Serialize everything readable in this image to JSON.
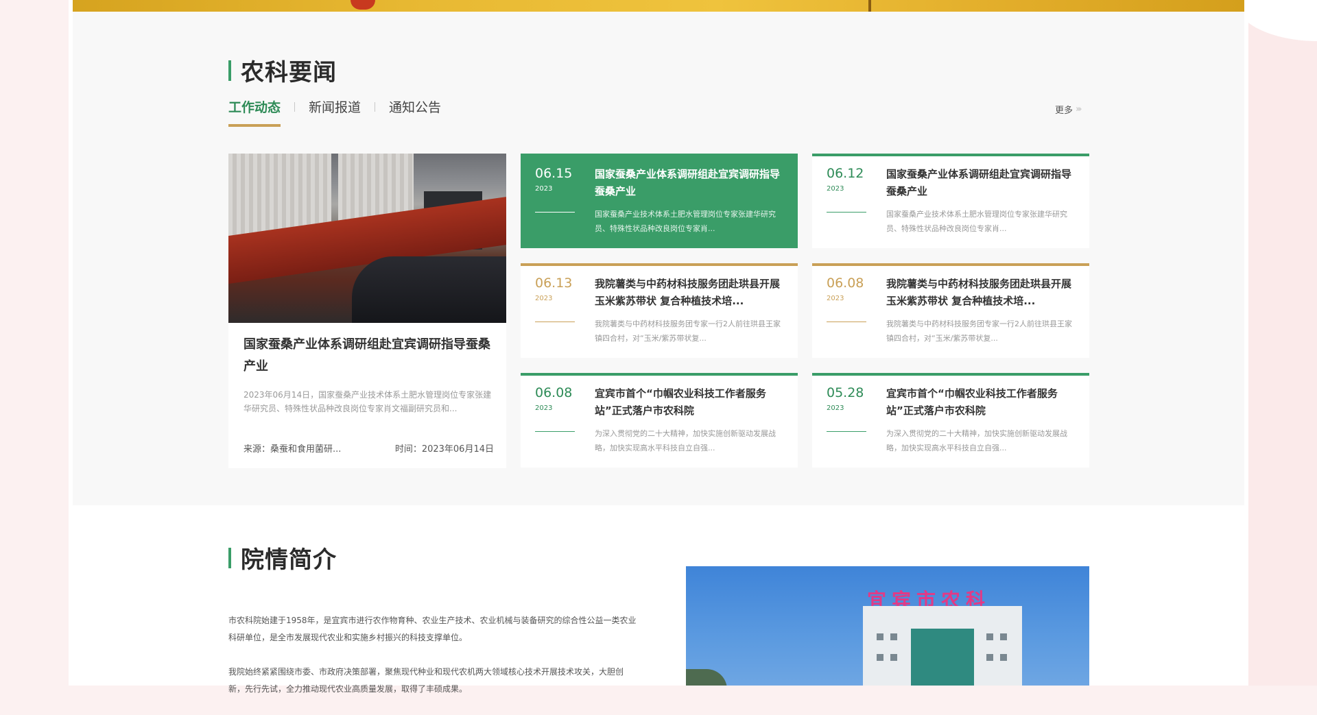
{
  "news_section": {
    "title": "农科要闻",
    "tabs": [
      {
        "label": "工作动态",
        "active": true
      },
      {
        "label": "新闻报道",
        "active": false
      },
      {
        "label": "通知公告",
        "active": false
      }
    ],
    "more_label": "更多",
    "featured": {
      "title": "国家蚕桑产业体系调研组赴宜宾调研指导蚕桑产业",
      "summary": "2023年06月14日，国家蚕桑产业技术体系土肥水管理岗位专家张建华研究员、特殊性状品种改良岗位专家肖文福副研究员和...",
      "source_label": "来源：",
      "source_value": "桑蚕和食用菌研...",
      "time_label": "时间：",
      "time_value": "2023年06月14日"
    },
    "cards": [
      {
        "date": "06.15",
        "year": "2023",
        "title": "国家蚕桑产业体系调研组赴宜宾调研指导蚕桑产业",
        "summary": "国家蚕桑产业技术体系土肥水管理岗位专家张建华研究员、特殊性状品种改良岗位专家肖...",
        "style": "highlight"
      },
      {
        "date": "06.12",
        "year": "2023",
        "title": "国家蚕桑产业体系调研组赴宜宾调研指导蚕桑产业",
        "summary": "国家蚕桑产业技术体系土肥水管理岗位专家张建华研究员、特殊性状品种改良岗位专家肖...",
        "style": "green"
      },
      {
        "date": "06.13",
        "year": "2023",
        "title": "我院薯类与中药材科技服务团赴珙县开展玉米紫苏带状 复合种植技术培...",
        "summary": "我院薯类与中药材科技服务团专家一行2人前往珙县王家镇四合村，对“玉米/紫苏带状复...",
        "style": "gold"
      },
      {
        "date": "06.08",
        "year": "2023",
        "title": "我院薯类与中药材科技服务团赴珙县开展玉米紫苏带状 复合种植技术培...",
        "summary": "我院薯类与中药材科技服务团专家一行2人前往珙县王家镇四合村，对“玉米/紫苏带状复...",
        "style": "gold"
      },
      {
        "date": "06.08",
        "year": "2023",
        "title": "宜宾市首个“巾帼农业科技工作者服务站”正式落户市农科院",
        "summary": "为深入贯彻党的二十大精神，加快实施创新驱动发展战略，加快实现高水平科技自立自强...",
        "style": "green"
      },
      {
        "date": "05.28",
        "year": "2023",
        "title": "宜宾市首个“巾帼农业科技工作者服务站”正式落户市农科院",
        "summary": "为深入贯彻党的二十大精神，加快实施创新驱动发展战略，加快实现高水平科技自立自强...",
        "style": "green"
      }
    ]
  },
  "intro_section": {
    "title": "院情简介",
    "paragraphs": [
      "市农科院始建于1958年，是宜宾市进行农作物育种、农业生产技术、农业机械与装备研究的综合性公益一类农业科研单位，是全市发展现代农业和实施乡村振兴的科技支撑单位。",
      "我院始终紧紧围绕市委、市政府决策部署，聚焦现代种业和现代农机两大领域核心技术开展技术攻关，大胆创新，先行先试，全力推动现代农业高质量发展，取得了丰硕成果。"
    ],
    "image_sign": "宜宾市农科院"
  }
}
